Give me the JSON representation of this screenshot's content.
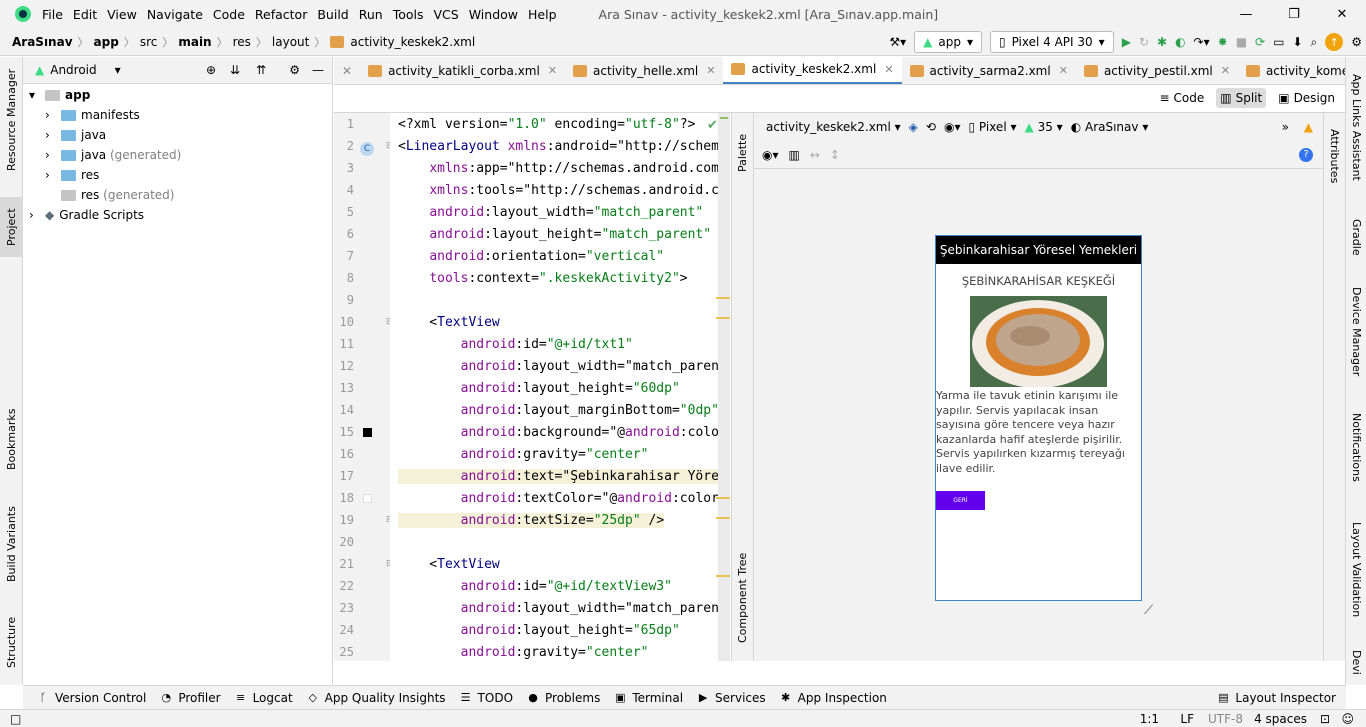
{
  "menubar": {
    "items": [
      "File",
      "Edit",
      "View",
      "Navigate",
      "Code",
      "Refactor",
      "Build",
      "Run",
      "Tools",
      "VCS",
      "Window",
      "Help"
    ],
    "title": "Ara Sınav - activity_keskek2.xml [Ara_Sınav.app.main]"
  },
  "breadcrumb": [
    "AraSınav",
    "app",
    "src",
    "main",
    "res",
    "layout",
    "activity_keskek2.xml"
  ],
  "run": {
    "config": "app",
    "device": "Pixel 4 API 30"
  },
  "project_panel": {
    "view": "Android",
    "tree": [
      {
        "label": "app",
        "extra": ""
      },
      {
        "label": "manifests",
        "extra": ""
      },
      {
        "label": "java",
        "extra": ""
      },
      {
        "label": "java",
        "extra": "(generated)"
      },
      {
        "label": "res",
        "extra": ""
      },
      {
        "label": "res",
        "extra": "(generated)"
      },
      {
        "label": "Gradle Scripts",
        "extra": ""
      }
    ]
  },
  "tabs": [
    "activity_katikli_corba.xml",
    "activity_helle.xml",
    "activity_keskek2.xml",
    "activity_sarma2.xml",
    "activity_pestil.xml",
    "activity_kome.xml"
  ],
  "modes": {
    "code": "Code",
    "split": "Split",
    "design": "Design"
  },
  "code_lines": [
    [
      "<?xml version=\"1.0\" encoding=\"utf-8\"?>"
    ],
    [
      "<LinearLayout xmlns:android=\"http://schema"
    ],
    [
      "    xmlns:app=\"http://schemas.android.com,"
    ],
    [
      "    xmlns:tools=\"http://schemas.android.co"
    ],
    [
      "    android:layout_width=\"match_parent\""
    ],
    [
      "    android:layout_height=\"match_parent\""
    ],
    [
      "    android:orientation=\"vertical\""
    ],
    [
      "    tools:context=\".keskekActivity2\">"
    ],
    [
      ""
    ],
    [
      "    <TextView"
    ],
    [
      "        android:id=\"@+id/txt1\""
    ],
    [
      "        android:layout_width=\"match_parent"
    ],
    [
      "        android:layout_height=\"60dp\""
    ],
    [
      "        android:layout_marginBottom=\"0dp\""
    ],
    [
      "        android:background=\"@android:color"
    ],
    [
      "        android:gravity=\"center\""
    ],
    [
      "        android:text=\"Şebinkarahisar Yöres"
    ],
    [
      "        android:textColor=\"@android:color/"
    ],
    [
      "        android:textSize=\"25dp\" />"
    ],
    [
      ""
    ],
    [
      "    <TextView"
    ],
    [
      "        android:id=\"@+id/textView3\""
    ],
    [
      "        android:layout_width=\"match_parent"
    ],
    [
      "        android:layout_height=\"65dp\""
    ],
    [
      "        android:gravity=\"center\""
    ]
  ],
  "design": {
    "file": "activity_keskek2.xml",
    "device": "Pixel",
    "api": "35",
    "theme": "AraSınav"
  },
  "preview": {
    "header": "Şebinkarahisar Yöresel Yemekleri",
    "subtitle": "ŞEBİNKARAHİSAR KEŞKEĞİ",
    "body": "Yarma ile tavuk etinin karışımı ile yapılır. Servis yapılacak insan sayısına göre tencere veya hazır kazanlarda hafif ateşlerde pişirilir. Servis yapılırken kızarmış tereyağı ilave edilir.",
    "button": "GERİ",
    "button_color": "#6200ee"
  },
  "palette_label": "Palette",
  "component_tree_label": "Component Tree",
  "left_tabs": [
    "Resource Manager",
    "Project",
    "Bookmarks",
    "Build Variants",
    "Structure"
  ],
  "right_tabs": [
    "App Links Assistant",
    "Gradle",
    "Device Manager",
    "Notifications",
    "Layout Validation",
    "Devi"
  ],
  "attributes_label": "Attributes",
  "bottom_tabs": [
    "Version Control",
    "Profiler",
    "Logcat",
    "App Quality Insights",
    "TODO",
    "Problems",
    "Terminal",
    "Services",
    "App Inspection"
  ],
  "layout_inspector": "Layout Inspector",
  "status": {
    "pos": "1:1",
    "le": "LF",
    "enc": "UTF-8",
    "indent": "4 spaces"
  }
}
